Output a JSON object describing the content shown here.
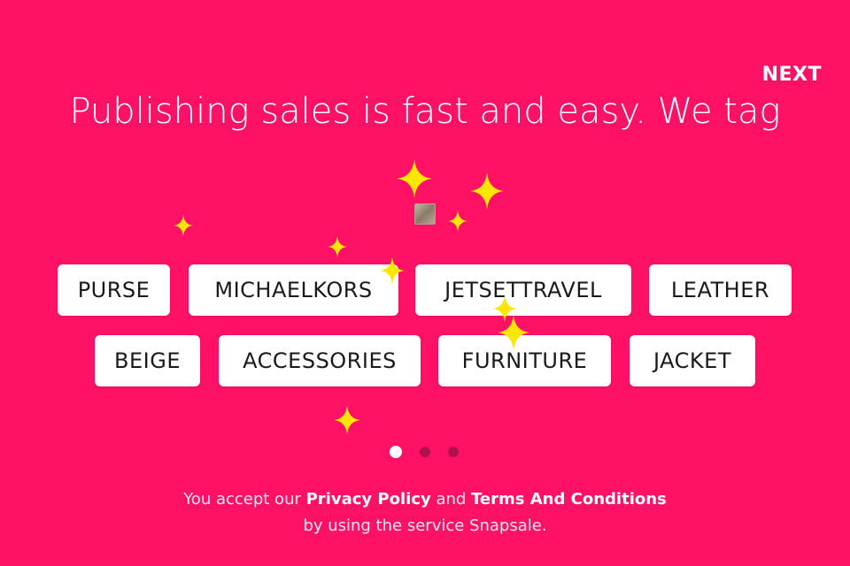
{
  "header": {
    "next_label": "NEXT"
  },
  "headline": "Publishing sales is fast and easy. We tag",
  "tags": [
    "PURSE",
    "MICHAELKORS",
    "JETSETTRAVEL",
    "LEATHER",
    "BEIGE",
    "ACCESSORIES",
    "FURNITURE",
    "JACKET"
  ],
  "pager": {
    "pages": 3,
    "current": 1
  },
  "legal": {
    "prefix": "You accept our",
    "privacy_link": "Privacy Policy",
    "and": "and",
    "terms_link": "Terms And Conditions",
    "line2": "by using the service Snapsale."
  },
  "colors": {
    "background": "#FF1166",
    "sparkle": "#FFE600",
    "tag_bg": "#FFFFFF",
    "tag_text": "#1A1A1A"
  },
  "icons": {
    "sparkle": "sparkle-icon",
    "thumbnail": "product-thumbnail"
  }
}
